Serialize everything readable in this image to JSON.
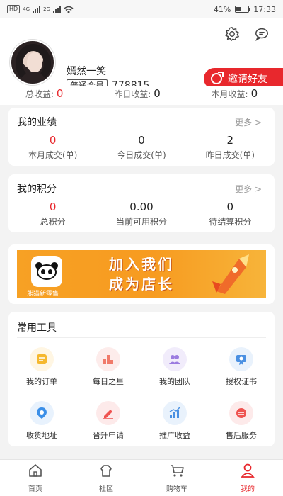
{
  "status_bar": {
    "network": "HD",
    "signal_1": "4G",
    "signal_2": "2G",
    "battery": "41%",
    "time": "17:33"
  },
  "profile": {
    "name": "嫣然一笑",
    "member_level": "普通会员",
    "member_id": "778815",
    "invite_label": "邀请好友"
  },
  "earnings": [
    {
      "label": "总收益:",
      "value": "0",
      "color": "#e8282d"
    },
    {
      "label": "昨日收益:",
      "value": "0",
      "color": "#222222"
    },
    {
      "label": "本月收益:",
      "value": "0",
      "color": "#222222"
    }
  ],
  "performance": {
    "title": "我的业绩",
    "more": "更多 >",
    "stats": [
      {
        "value": "0",
        "label": "本月成交(单)"
      },
      {
        "value": "0",
        "label": "今日成交(单)"
      },
      {
        "value": "2",
        "label": "昨日成交(单)"
      }
    ]
  },
  "points": {
    "title": "我的积分",
    "more": "更多 >",
    "stats": [
      {
        "value": "0",
        "label": "总积分"
      },
      {
        "value": "0.00",
        "label": "当前可用积分"
      },
      {
        "value": "0",
        "label": "待结算积分"
      }
    ]
  },
  "banner": {
    "brand": "熊猫新零售",
    "line1": "加入我们",
    "line2": "成为店长"
  },
  "tools": {
    "title": "常用工具",
    "items": [
      {
        "label": "我的订单",
        "icon": "order-icon",
        "color": "#f5b82e",
        "bg": "#fff6e3"
      },
      {
        "label": "每日之星",
        "icon": "star-chart-icon",
        "color": "#f07a6a",
        "bg": "#fdeceb"
      },
      {
        "label": "我的团队",
        "icon": "team-icon",
        "color": "#9b7be0",
        "bg": "#f1ecfb"
      },
      {
        "label": "授权证书",
        "icon": "certificate-icon",
        "color": "#4a90e2",
        "bg": "#e9f2fc"
      },
      {
        "label": "收货地址",
        "icon": "location-icon",
        "color": "#3b8fe8",
        "bg": "#e8f2fd"
      },
      {
        "label": "晋升申请",
        "icon": "edit-icon",
        "color": "#ef5350",
        "bg": "#fdeaea"
      },
      {
        "label": "推广收益",
        "icon": "growth-chart-icon",
        "color": "#4a90e2",
        "bg": "#e9f2fc"
      },
      {
        "label": "售后服务",
        "icon": "service-icon",
        "color": "#ef5350",
        "bg": "#fdeaea"
      }
    ]
  },
  "tabbar": [
    {
      "label": "首页",
      "icon": "home-icon",
      "active": false
    },
    {
      "label": "社区",
      "icon": "community-icon",
      "active": false
    },
    {
      "label": "购物车",
      "icon": "cart-icon",
      "active": false
    },
    {
      "label": "我的",
      "icon": "profile-icon",
      "active": true
    }
  ],
  "colors": {
    "accent": "#e8282d",
    "banner": "#f79b20"
  }
}
